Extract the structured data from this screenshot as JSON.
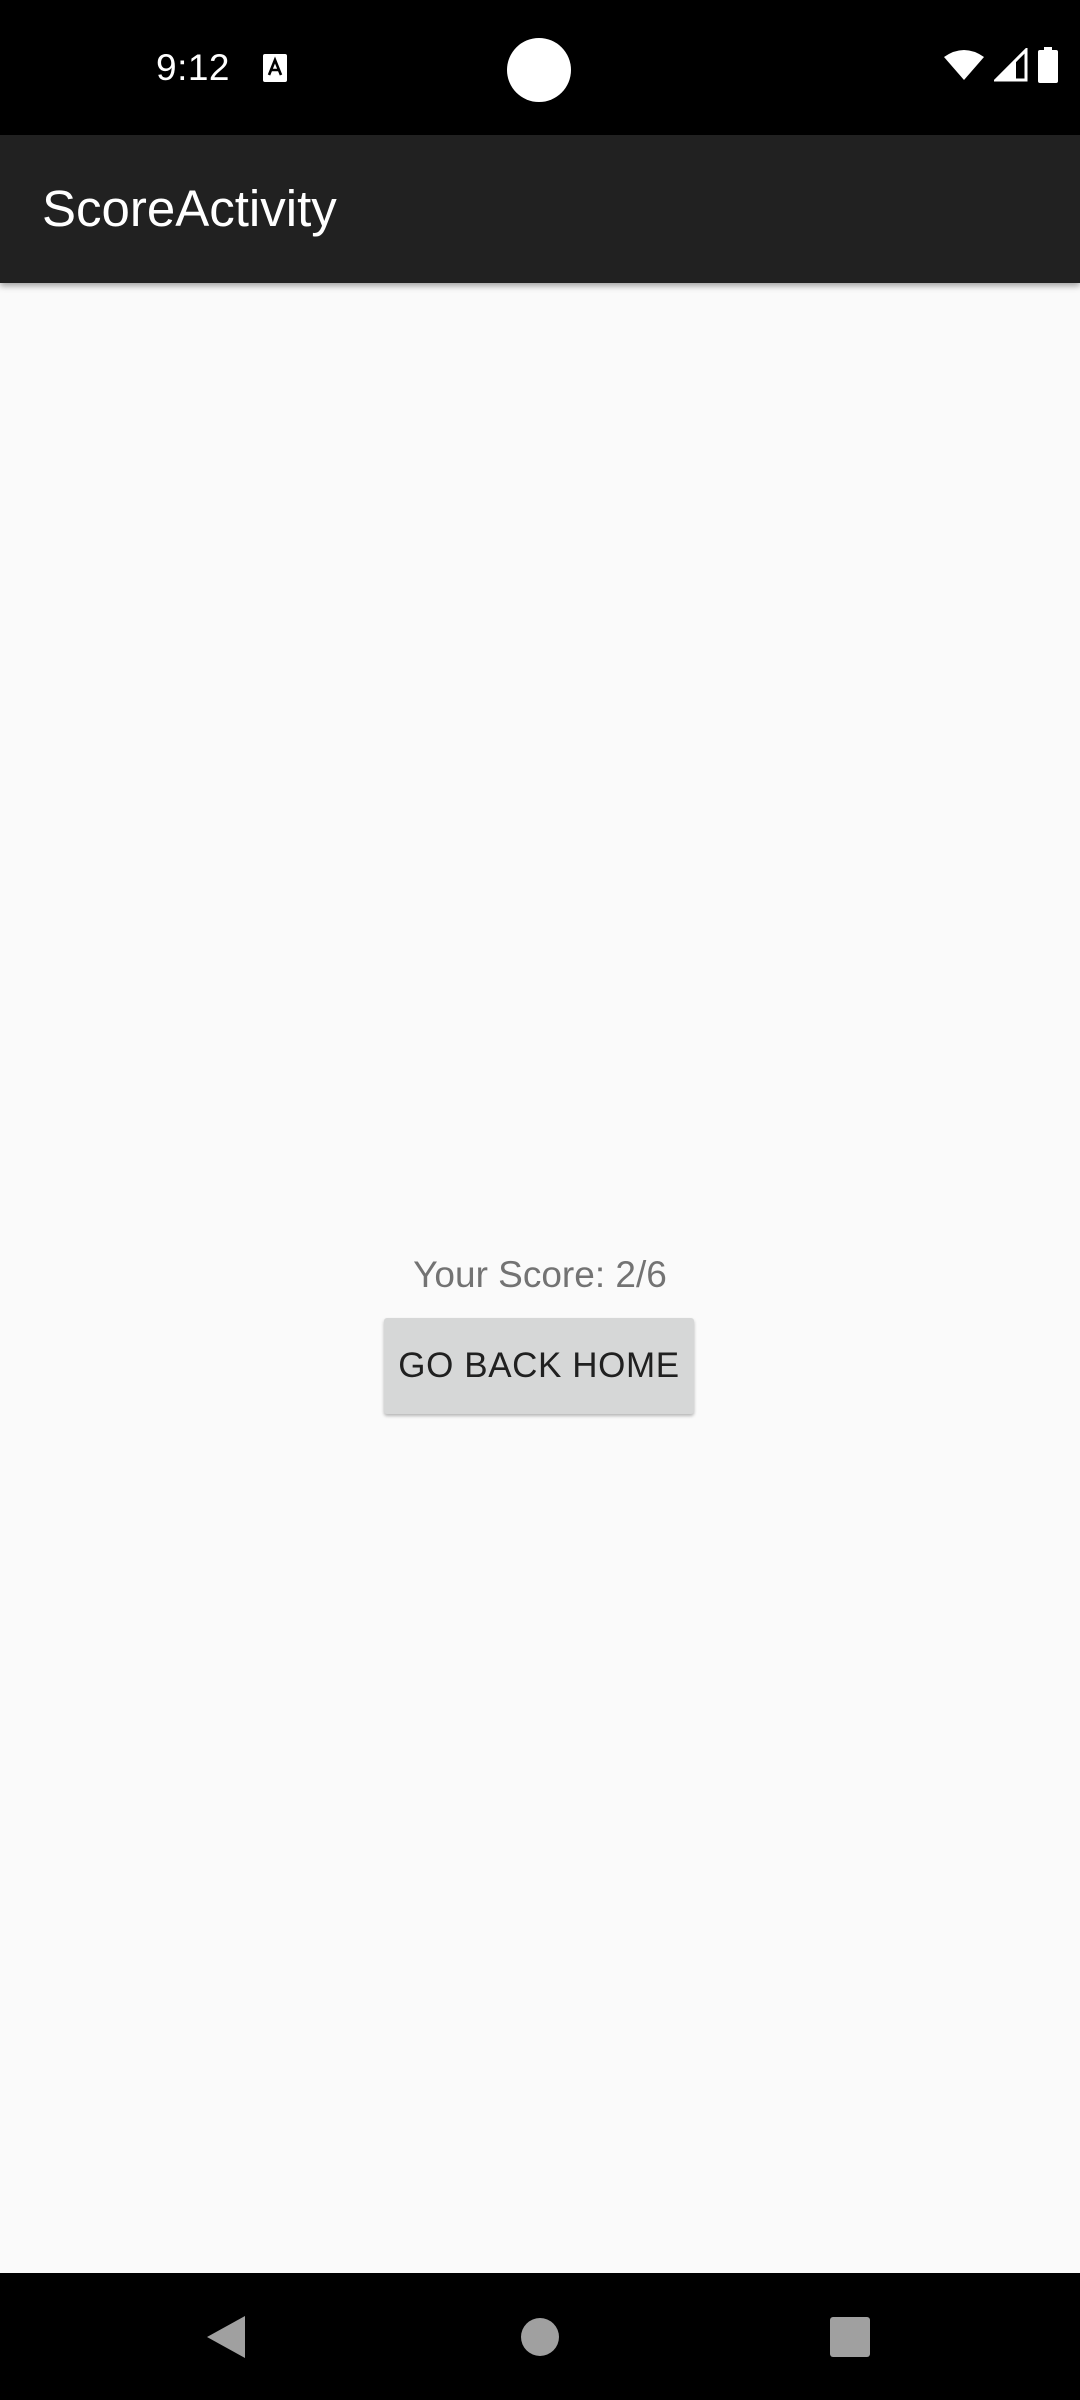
{
  "status_bar": {
    "time": "9:12",
    "icons": [
      "notification-a-icon",
      "wifi-icon",
      "cell-signal-icon",
      "battery-icon"
    ]
  },
  "app_bar": {
    "title": "ScoreActivity",
    "background": "#212121"
  },
  "content": {
    "score_text": "Your Score: 2/6",
    "button_label": "GO BACK HOME",
    "background": "#fafafa"
  },
  "nav_bar": {
    "icons": [
      "back-icon",
      "home-icon",
      "recents-icon"
    ]
  }
}
